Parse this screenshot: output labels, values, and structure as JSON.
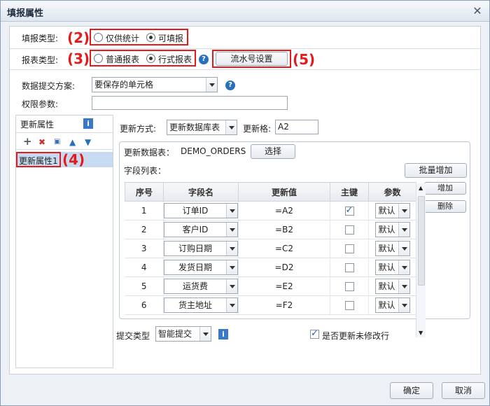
{
  "window": {
    "title": "填报属性",
    "close_icon": "close-icon"
  },
  "fill_type": {
    "label": "填报类型:",
    "marker": "(2)",
    "options": [
      {
        "label": "仅供统计",
        "selected": false
      },
      {
        "label": "可填报",
        "selected": true
      }
    ]
  },
  "report_type": {
    "label": "报表类型:",
    "marker": "(3)",
    "options": [
      {
        "label": "普通报表",
        "selected": false
      },
      {
        "label": "行式报表",
        "selected": true
      }
    ],
    "serial_button": "流水号设置",
    "serial_marker": "(5)"
  },
  "submit_scheme": {
    "label": "数据提交方案:",
    "value": "要保存的单元格"
  },
  "permission": {
    "label": "权限参数:",
    "value": ""
  },
  "sidebar": {
    "title": "更新属性",
    "item": "更新属性1",
    "item_marker": "(4)",
    "icons": [
      "add-icon",
      "delete-icon",
      "copy-icon",
      "move-up-icon",
      "move-down-icon"
    ]
  },
  "update": {
    "mode_label": "更新方式:",
    "mode_value": "更新数据库表",
    "cell_label": "更新格:",
    "cell_value": "A2",
    "table_label": "更新数据表：",
    "table_value": "DEMO_ORDERS",
    "select_button": "选择",
    "fields_label": "字段列表：",
    "batch_add": "批量增加",
    "add": "增加",
    "delete": "删除"
  },
  "grid": {
    "headers": [
      "序号",
      "字段名",
      "更新值",
      "主键",
      "参数"
    ],
    "rows": [
      {
        "no": "1",
        "field": "订单ID",
        "value": "=A2",
        "key": true,
        "param": "默认"
      },
      {
        "no": "2",
        "field": "客户ID",
        "value": "=B2",
        "key": false,
        "param": "默认"
      },
      {
        "no": "3",
        "field": "订购日期",
        "value": "=C2",
        "key": false,
        "param": "默认"
      },
      {
        "no": "4",
        "field": "发货日期",
        "value": "=D2",
        "key": false,
        "param": "默认"
      },
      {
        "no": "5",
        "field": "运货费",
        "value": "=E2",
        "key": false,
        "param": "默认"
      },
      {
        "no": "6",
        "field": "货主地址",
        "value": "=F2",
        "key": false,
        "param": "默认"
      }
    ]
  },
  "submit": {
    "label": "提交类型",
    "value": "智能提交",
    "update_unmodified": "是否更新未修改行",
    "update_unmodified_checked": true
  },
  "footer": {
    "ok": "确定",
    "cancel": "取消"
  },
  "colors": {
    "marker": "#e51b1b",
    "selection": "#c6dbf2",
    "help": "#2a6fbd"
  }
}
